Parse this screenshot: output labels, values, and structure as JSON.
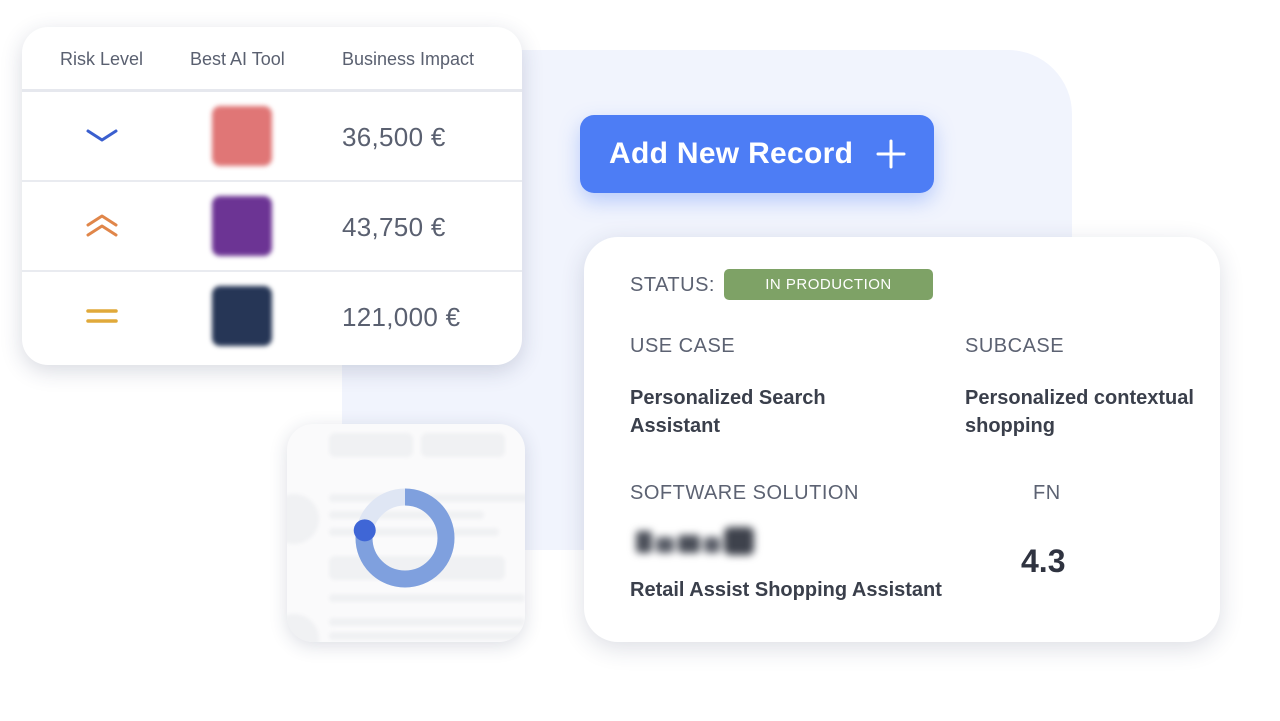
{
  "table": {
    "headers": [
      "Risk Level",
      "Best AI Tool",
      "Business Impact"
    ],
    "rows": [
      {
        "risk": "chevron-down-icon",
        "tool_color": "#e07676",
        "impact": "36,500 €"
      },
      {
        "risk": "double-chevron-up-icon",
        "tool_color": "#6c3494",
        "impact": "43,750 €"
      },
      {
        "risk": "equals-icon",
        "tool_color": "#263656",
        "impact": "121,000 €"
      }
    ]
  },
  "add_button": {
    "label": "Add New Record",
    "icon": "plus-icon"
  },
  "record": {
    "status_label": "STATUS:",
    "status_value": "IN PRODUCTION",
    "use_case_label": "USE CASE",
    "use_case_value": "Personalized Search Assistant",
    "subcase_label": "SUBCASE",
    "subcase_value": "Personalized contextual shopping",
    "software_label": "SOFTWARE SOLUTION",
    "software_value": "Retail Assist Shopping Assistant",
    "fn_label": "FN",
    "fn_value": "4.3"
  },
  "mini_card": {
    "donut_fraction": 0.78
  },
  "colors": {
    "accent": "#4d7df5",
    "status_green": "#7ea266",
    "risk_low": "#3a5fcf",
    "risk_high": "#e0864a",
    "risk_medium": "#e0a93a"
  }
}
